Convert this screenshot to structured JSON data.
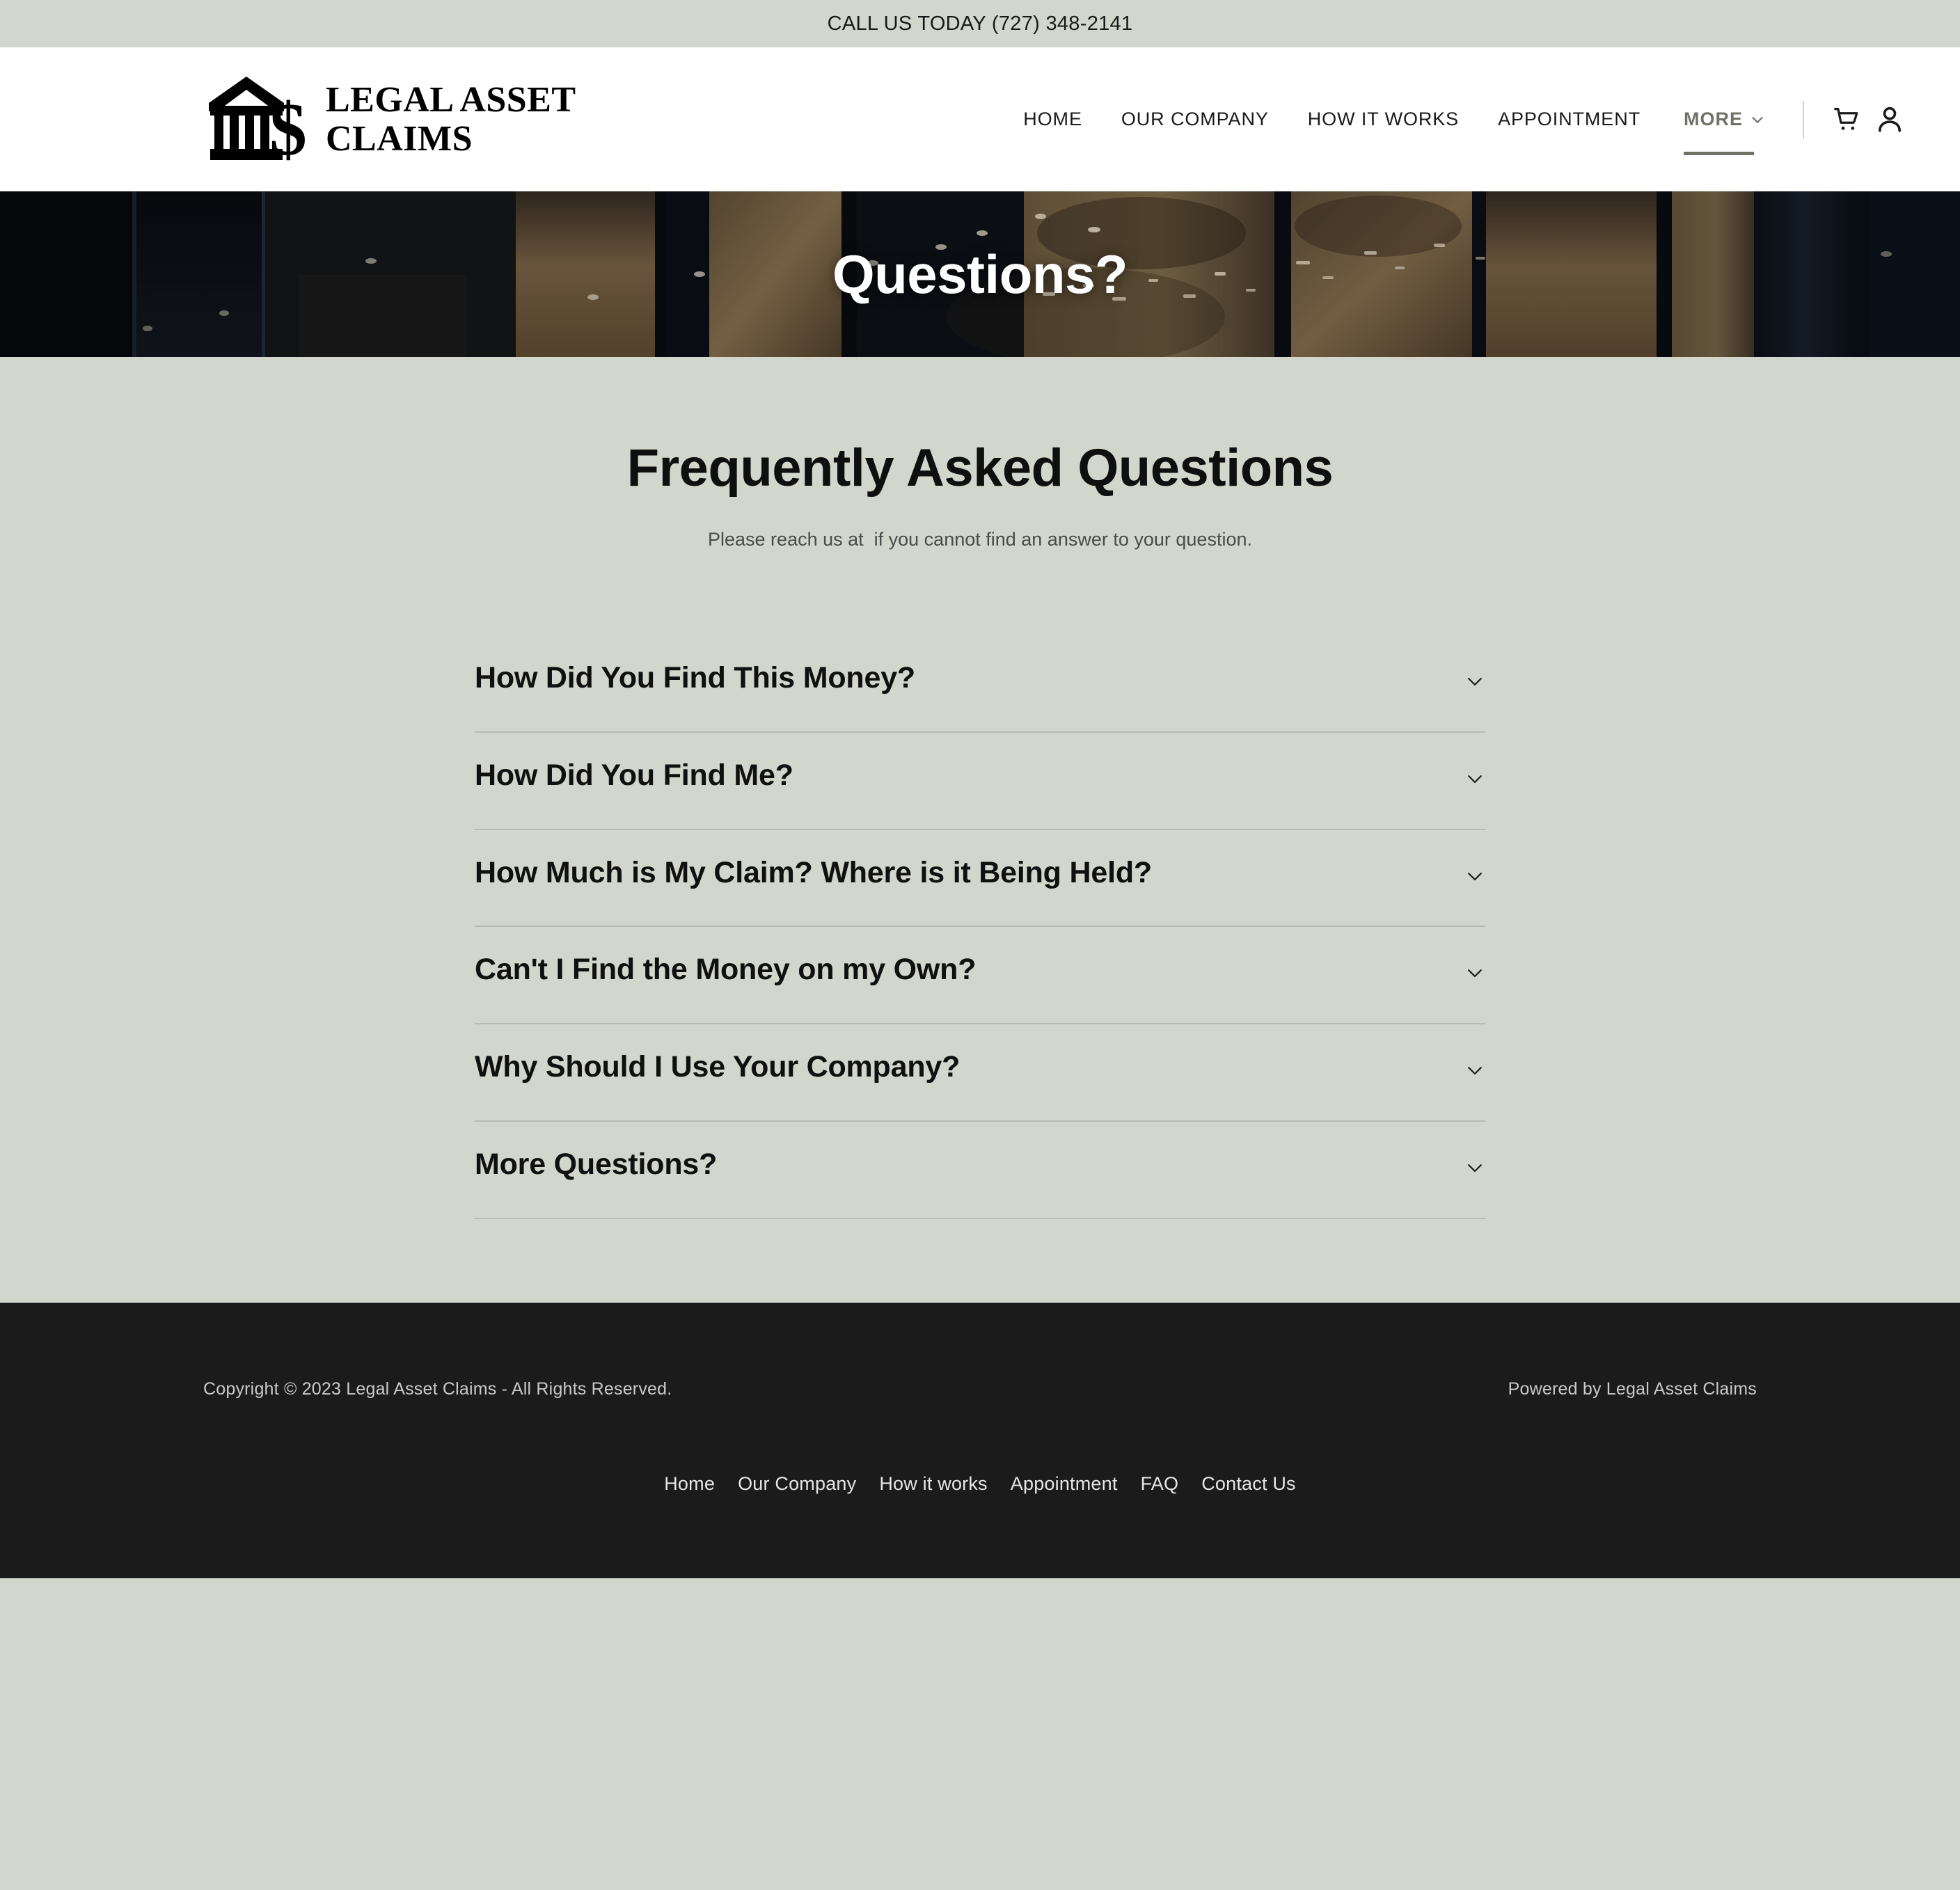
{
  "topbar": {
    "text": "CALL US TODAY (727) 348-2141"
  },
  "brand": {
    "name": "LEGAL ASSET\nCLAIMS",
    "logo_icon": "bank-dollar-icon"
  },
  "nav": {
    "items": [
      {
        "label": "HOME",
        "name": "nav-item-home"
      },
      {
        "label": "OUR COMPANY",
        "name": "nav-item-our-company"
      },
      {
        "label": "HOW IT WORKS",
        "name": "nav-item-how-it-works"
      },
      {
        "label": "APPOINTMENT",
        "name": "nav-item-appointment"
      }
    ],
    "more": {
      "label": "MORE",
      "icon": "chevron-down-icon",
      "color": "#6f7265"
    },
    "cart_icon": "shopping-cart-icon",
    "account_icon": "user-account-icon"
  },
  "hero": {
    "title": "Questions?"
  },
  "faq": {
    "heading": "Frequently Asked Questions",
    "subtext": "Please reach us at  if you cannot find an answer to your question.",
    "items": [
      {
        "question": "How Did You Find This Money?"
      },
      {
        "question": "How Did You Find Me?"
      },
      {
        "question": "How Much is My Claim? Where is it Being Held?"
      },
      {
        "question": "Can't I Find the Money on my Own?"
      },
      {
        "question": "Why Should I Use Your Company?"
      },
      {
        "question": "More Questions?"
      }
    ]
  },
  "footer": {
    "copyright": "Copyright © 2023 Legal Asset Claims - All Rights Reserved.",
    "powered_by": "Powered by Legal Asset Claims",
    "links": [
      {
        "label": "Home",
        "name": "footer-link-home"
      },
      {
        "label": "Our Company",
        "name": "footer-link-our-company"
      },
      {
        "label": "How it works",
        "name": "footer-link-how-it-works"
      },
      {
        "label": "Appointment",
        "name": "footer-link-appointment"
      },
      {
        "label": "FAQ",
        "name": "footer-link-faq"
      },
      {
        "label": "Contact Us",
        "name": "footer-link-contact-us"
      }
    ]
  },
  "colors": {
    "page_bg": "#d2d6cc",
    "header_bg": "#ffffff",
    "footer_bg": "#1b1b1b",
    "accent": "#6f7265",
    "divider": "#b7bbb2"
  }
}
